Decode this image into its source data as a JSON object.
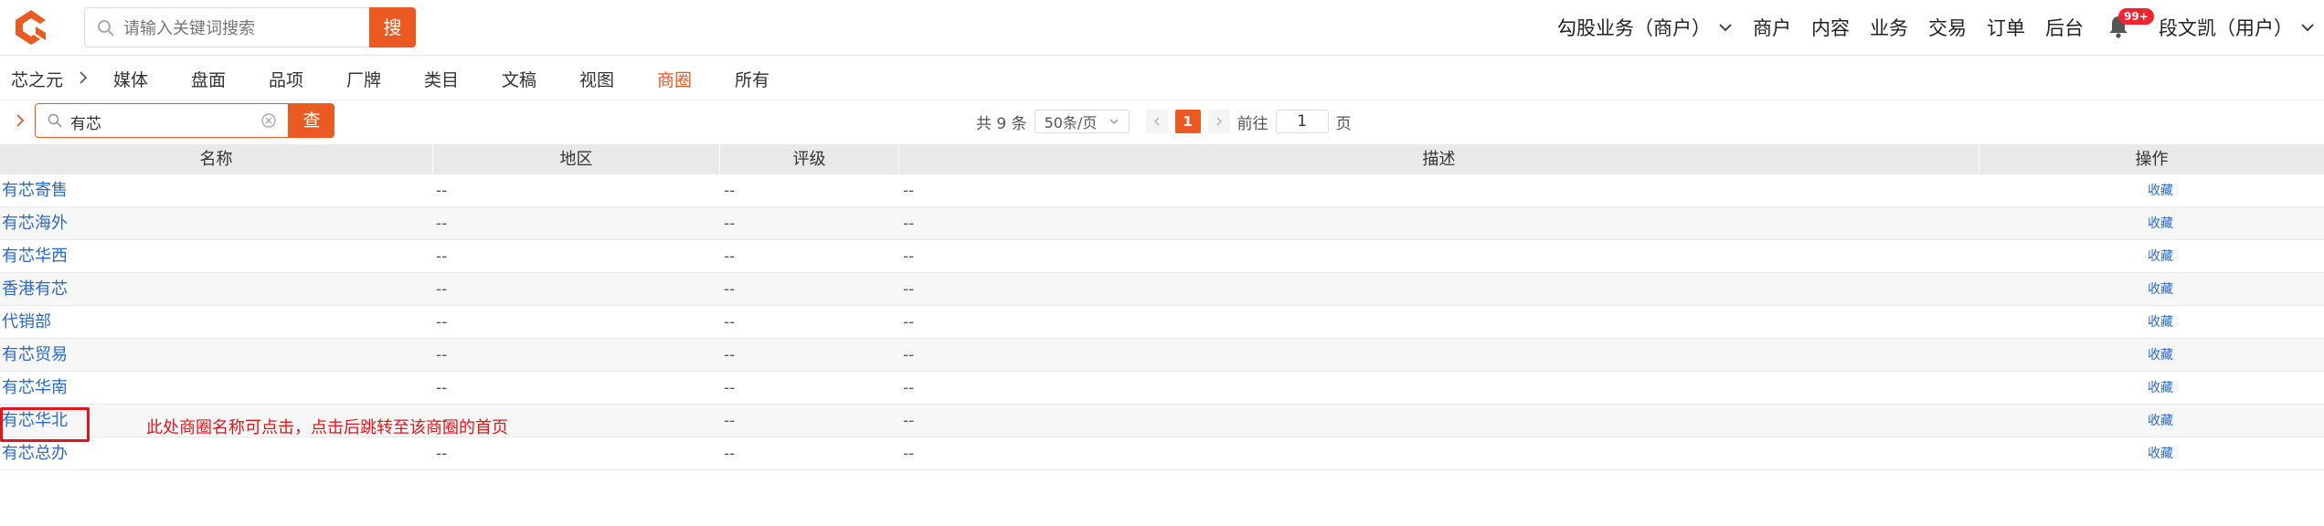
{
  "header": {
    "search_placeholder": "请输入关键词搜索",
    "search_button": "搜",
    "nav": {
      "mode": "勾股业务（商户）",
      "items": [
        "商户",
        "内容",
        "业务",
        "交易",
        "订单",
        "后台"
      ],
      "notification_count": "99+",
      "user": "段文凯（用户）"
    }
  },
  "subnav": {
    "home": "芯之元",
    "tabs": [
      "媒体",
      "盘面",
      "品项",
      "厂牌",
      "类目",
      "文稿",
      "视图",
      "商圈",
      "所有"
    ],
    "active_tab": "商圈"
  },
  "toolbar": {
    "filter_value": "有芯",
    "query_button": "查",
    "pager": {
      "total": "共 9 条",
      "page_size": "50条/页",
      "current_page": "1",
      "goto_label": "前往",
      "goto_value": "1",
      "page_unit": "页"
    }
  },
  "table": {
    "columns": [
      "名称",
      "地区",
      "评级",
      "描述",
      "操作"
    ],
    "rows": [
      {
        "name": "有芯寄售",
        "region": "--",
        "rating": "--",
        "desc": "--",
        "action": "收藏"
      },
      {
        "name": "有芯海外",
        "region": "--",
        "rating": "--",
        "desc": "--",
        "action": "收藏"
      },
      {
        "name": "有芯华西",
        "region": "--",
        "rating": "--",
        "desc": "--",
        "action": "收藏"
      },
      {
        "name": "香港有芯",
        "region": "--",
        "rating": "--",
        "desc": "--",
        "action": "收藏"
      },
      {
        "name": "代销部",
        "region": "--",
        "rating": "--",
        "desc": "--",
        "action": "收藏"
      },
      {
        "name": "有芯贸易",
        "region": "--",
        "rating": "--",
        "desc": "--",
        "action": "收藏"
      },
      {
        "name": "有芯华南",
        "region": "--",
        "rating": "--",
        "desc": "--",
        "action": "收藏"
      },
      {
        "name": "有芯华北",
        "region": "--",
        "rating": "--",
        "desc": "--",
        "action": "收藏"
      },
      {
        "name": "有芯总办",
        "region": "--",
        "rating": "--",
        "desc": "--",
        "action": "收藏"
      }
    ]
  },
  "annotation": {
    "note": "此处商圈名称可点击，点击后跳转至该商圈的首页"
  },
  "colors": {
    "accent": "#ec5a24",
    "link": "#2a6ac7",
    "annotation": "#e0161c",
    "header_bg": "#e9e9e9"
  }
}
